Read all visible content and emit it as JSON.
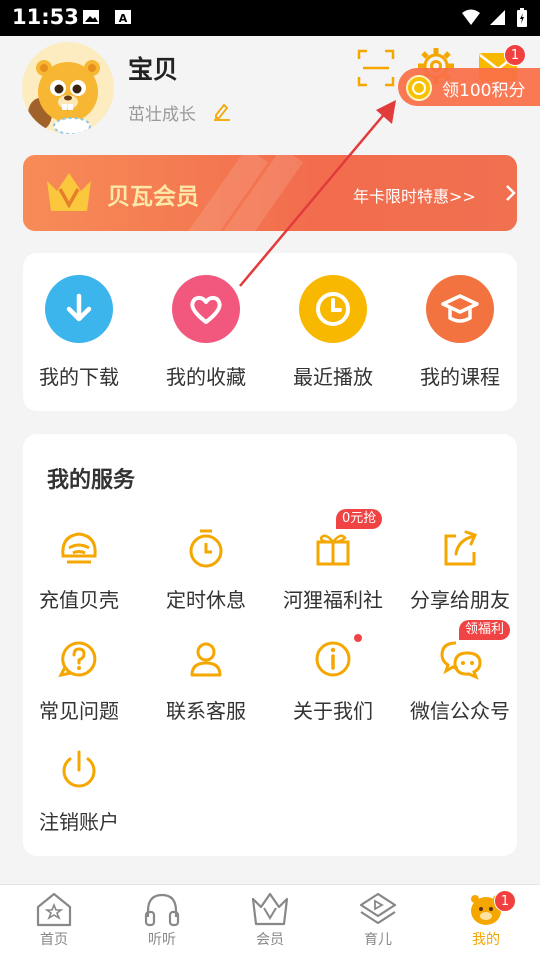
{
  "status_bar": {
    "time": "11:53"
  },
  "profile": {
    "name": "宝贝",
    "growth_label": "茁壮成长",
    "mail_badge": "1",
    "points_promo": "领100积分"
  },
  "vip": {
    "title": "贝瓦会员",
    "promo": "年卡限时特惠>>"
  },
  "quick_actions": [
    {
      "label": "我的下载",
      "icon": "download-icon",
      "color": "#3cb4ec"
    },
    {
      "label": "我的收藏",
      "icon": "heart-icon",
      "color": "#f2577d"
    },
    {
      "label": "最近播放",
      "icon": "clock-icon",
      "color": "#f8b800"
    },
    {
      "label": "我的课程",
      "icon": "graduation-cap-icon",
      "color": "#f2733f"
    }
  ],
  "services": {
    "title": "我的服务",
    "items": [
      {
        "label": "充值贝壳",
        "icon": "shell-icon"
      },
      {
        "label": "定时休息",
        "icon": "timer-icon"
      },
      {
        "label": "河狸福利社",
        "icon": "gift-icon",
        "tag": "0元抢"
      },
      {
        "label": "分享给朋友",
        "icon": "share-icon"
      },
      {
        "label": "常见问题",
        "icon": "question-icon"
      },
      {
        "label": "联系客服",
        "icon": "customer-service-icon"
      },
      {
        "label": "关于我们",
        "icon": "info-icon"
      },
      {
        "label": "微信公众号",
        "icon": "wechat-icon",
        "tag": "领福利"
      },
      {
        "label": "注销账户",
        "icon": "power-icon"
      }
    ]
  },
  "tabs": [
    {
      "label": "首页",
      "icon": "home-icon"
    },
    {
      "label": "听听",
      "icon": "headphones-icon"
    },
    {
      "label": "会员",
      "icon": "crown-icon"
    },
    {
      "label": "育儿",
      "icon": "parenting-icon"
    },
    {
      "label": "我的",
      "icon": "mine-icon",
      "active": true,
      "badge": "1"
    }
  ],
  "colors": {
    "accent": "#f5a700",
    "vip_orange": "#f26c4d",
    "badge_red": "#f04040"
  }
}
